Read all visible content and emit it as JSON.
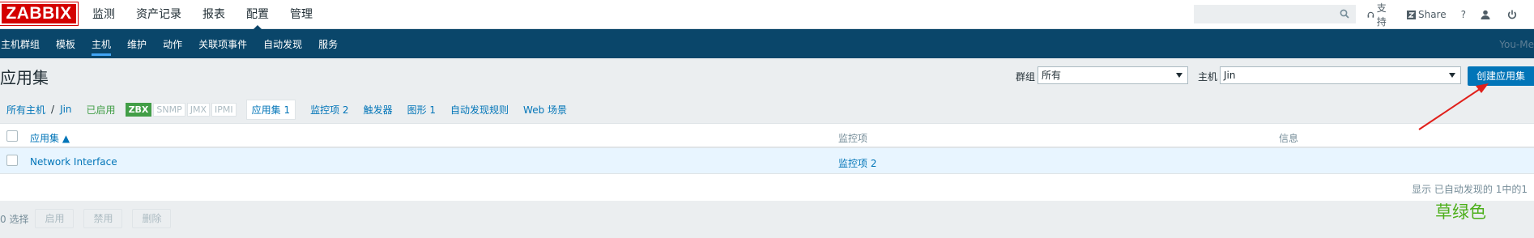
{
  "logo": {
    "text": "ZABBIX"
  },
  "main_menu": [
    "监测",
    "资产记录",
    "报表",
    "配置",
    "管理"
  ],
  "top_links": {
    "support": "支持",
    "share": "Share",
    "help": "?"
  },
  "sub_menu": [
    "主机群组",
    "模板",
    "主机",
    "维护",
    "动作",
    "关联项事件",
    "自动发现",
    "服务"
  ],
  "user_label": "You-Me",
  "page": {
    "title": "应用集",
    "group_label": "群组",
    "group_value": "所有",
    "host_label": "主机",
    "host_value": "Jin",
    "create_button": "创建应用集"
  },
  "filter_bar": {
    "all_hosts": "所有主机",
    "separator": "/",
    "host": "Jin",
    "status": "已启用",
    "tags": [
      "ZBX",
      "SNMP",
      "JMX",
      "IPMI"
    ],
    "applications": "应用集 1",
    "items": "监控项 2",
    "triggers": "触发器",
    "graphs": "图形 1",
    "discovery": "自动发现规则",
    "web": "Web 场景"
  },
  "table": {
    "columns": [
      "应用集 ▲",
      "监控项",
      "信息"
    ],
    "rows": [
      {
        "name": "Network Interface",
        "items": "监控项 2",
        "info": ""
      }
    ],
    "footer": "显示 已自动发现的 1中的1"
  },
  "actions": {
    "selected": "0 选择",
    "enable": "启用",
    "disable": "禁用",
    "delete": "删除"
  },
  "annotation": {
    "text": "草绿色",
    "color": "#4caf1a",
    "arrow_color": "#e0201b"
  },
  "colors": {
    "nav_dark": "#0a466a",
    "accent": "#0275b8",
    "green": "#429e47"
  }
}
